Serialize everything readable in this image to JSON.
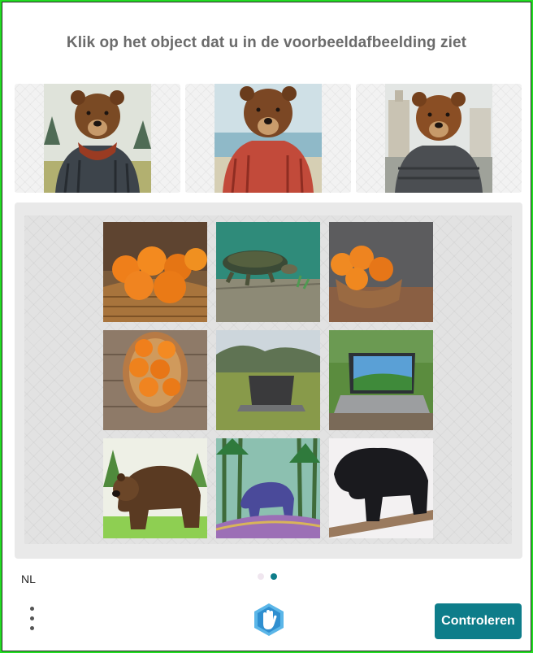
{
  "challenge": {
    "prompt": "Klik op het object dat u in de voorbeeldafbeelding ziet"
  },
  "examples": [
    {
      "subject": "bear-in-gray-puffer-jacket-with-red-scarf"
    },
    {
      "subject": "bear-in-red-puffer-jacket"
    },
    {
      "subject": "bear-in-gray-puffer-jacket-city"
    }
  ],
  "tiles": [
    {
      "subject": "oranges-in-basket"
    },
    {
      "subject": "turtle-on-ground"
    },
    {
      "subject": "oranges-in-bowl"
    },
    {
      "subject": "oranges-in-basket-top-view"
    },
    {
      "subject": "laptop-in-meadow"
    },
    {
      "subject": "laptop-on-table-outdoors"
    },
    {
      "subject": "brown-bear-painting"
    },
    {
      "subject": "blue-bear-in-forest"
    },
    {
      "subject": "black-bear-on-log"
    }
  ],
  "footer": {
    "language": "NL",
    "submit_label": "Controleren",
    "page_count": 2,
    "active_page": 2
  },
  "colors": {
    "accent": "#0e7d8a",
    "frame": "#22dd22",
    "prompt_text": "#6b6b6b",
    "dot_inactive": "#f0e6ef"
  },
  "icons": {
    "menu": "vertical-dots-icon",
    "logo": "hand-logo-icon"
  }
}
